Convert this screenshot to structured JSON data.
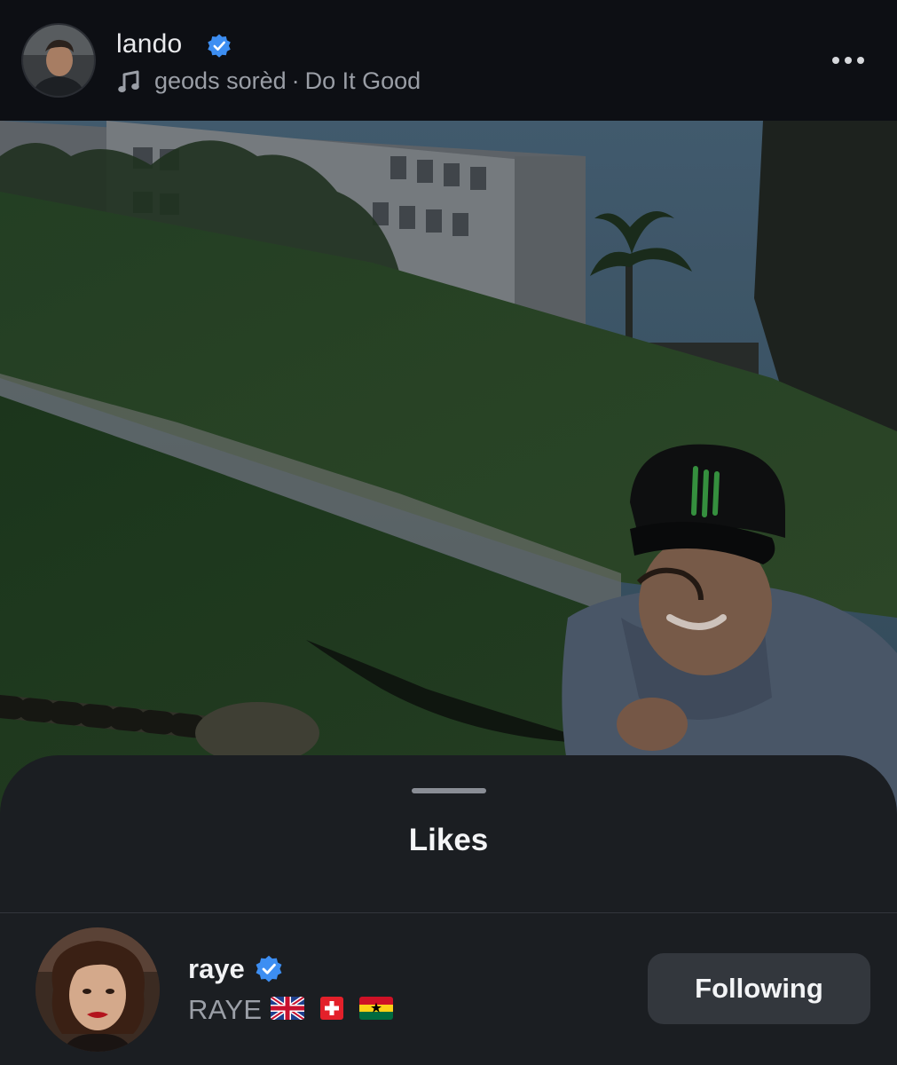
{
  "header": {
    "author_name": "lando",
    "audio": {
      "artist": "geods sorèd",
      "separator": "·",
      "track": "Do It Good"
    },
    "icons": {
      "music": "music-note-icon",
      "verified": "verified-badge-icon",
      "more": "more-options-icon"
    }
  },
  "sheet": {
    "title": "Likes",
    "likes": [
      {
        "username": "raye",
        "full_name": "RAYE",
        "flags": [
          "🇬🇧",
          "🇨🇭",
          "🇬🇭"
        ],
        "button_label": "Following",
        "verified": true
      }
    ]
  },
  "colors": {
    "background": "#0d0f14",
    "sheet": "#1b1e22",
    "verified": "#3d8ef2",
    "following_button": "#33373d",
    "secondary_text": "#9b9fa7"
  }
}
